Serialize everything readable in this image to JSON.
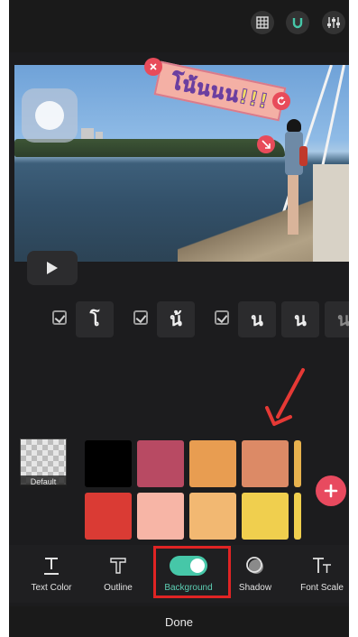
{
  "header": {
    "icons": [
      "grid-icon",
      "magnet-icon",
      "equalizer-icon"
    ]
  },
  "preview": {
    "sticker_text": "โน้นนน!!!",
    "play_icon": "play-icon"
  },
  "characters": [
    {
      "char": "โ",
      "checked": true
    },
    {
      "char": "น้",
      "checked": true
    },
    {
      "char": "น",
      "checked": true
    },
    {
      "char": "น",
      "checked": false
    },
    {
      "char": "น",
      "checked": false
    }
  ],
  "palette": {
    "default_label": "Default",
    "row1": [
      "#000000",
      "#b84a63",
      "#e89d51",
      "#dc8a66",
      "#e8b24e"
    ],
    "row2": [
      "#da3b34",
      "#f7b5a6",
      "#f2b872",
      "#f0cf4e",
      "#f0cf4e"
    ],
    "add_icon": "plus-icon"
  },
  "tools": [
    {
      "label": "Text Color",
      "icon": "text-underline-icon",
      "active": false
    },
    {
      "label": "Outline",
      "icon": "text-outline-icon",
      "active": false
    },
    {
      "label": "Background",
      "icon": "toggle-icon",
      "active": true
    },
    {
      "label": "Shadow",
      "icon": "shadow-icon",
      "active": false
    },
    {
      "label": "Font Scale",
      "icon": "font-scale-icon",
      "active": false
    }
  ],
  "footer": {
    "done_label": "Done"
  },
  "colors": {
    "accent": "#46c7a8",
    "add_button": "#e84a5f",
    "highlight_frame": "#e02424",
    "arrow": "#e53935"
  }
}
